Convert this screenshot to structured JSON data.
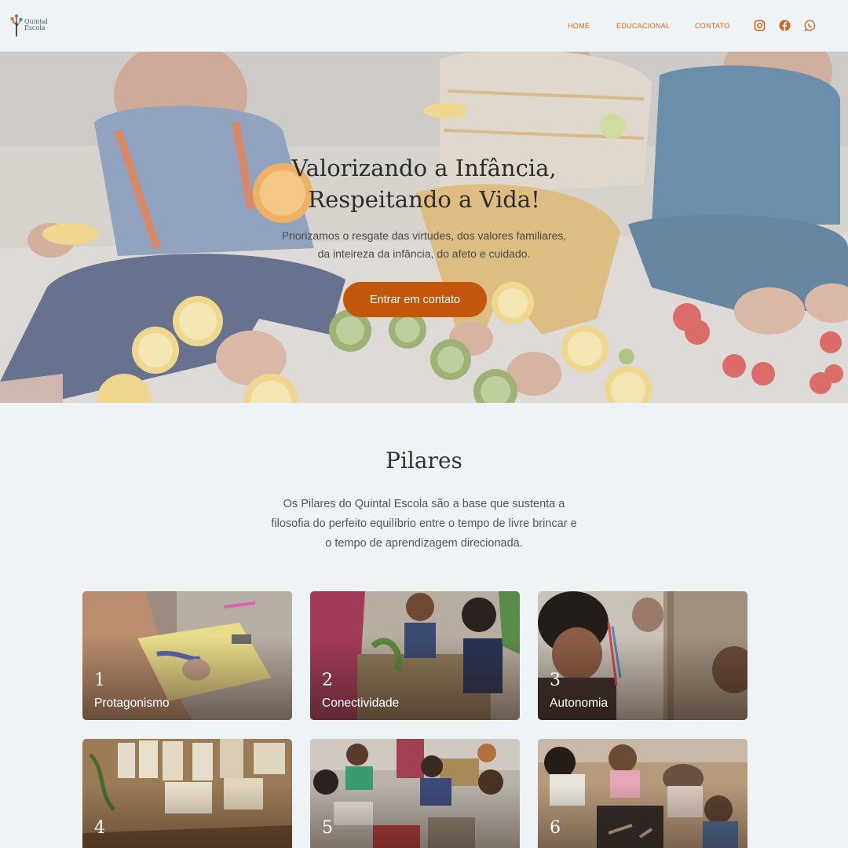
{
  "header": {
    "logo_text": "Quintal Escola",
    "nav": [
      "HOME",
      "EDUCACIONAL",
      "CONTATO"
    ],
    "social_icons": [
      "instagram-icon",
      "facebook-icon",
      "whatsapp-icon"
    ],
    "accent_color": "#d2651a"
  },
  "hero": {
    "title_line1": "Valorizando a Infância,",
    "title_line2": "Respeitando a Vida!",
    "subtitle_line1": "Priorizamos o resgate das virtudes, dos valores familiares,",
    "subtitle_line2": "da inteireza da infância, do afeto e cuidado.",
    "cta_label": "Entrar em contato",
    "cta_color": "#c2570c"
  },
  "pilares": {
    "title": "Pilares",
    "desc_line1": "Os Pilares do Quintal Escola são a base que sustenta a",
    "desc_line2": "filosofia do perfeito equilíbrio entre o tempo de livre brincar e",
    "desc_line3": "o tempo de aprendizagem direcionada.",
    "cards": [
      {
        "num": "1",
        "label": "Protagonismo"
      },
      {
        "num": "2",
        "label": "Conectividade"
      },
      {
        "num": "3",
        "label": "Autonomia"
      },
      {
        "num": "4",
        "label": ""
      },
      {
        "num": "5",
        "label": ""
      },
      {
        "num": "6",
        "label": ""
      }
    ]
  }
}
